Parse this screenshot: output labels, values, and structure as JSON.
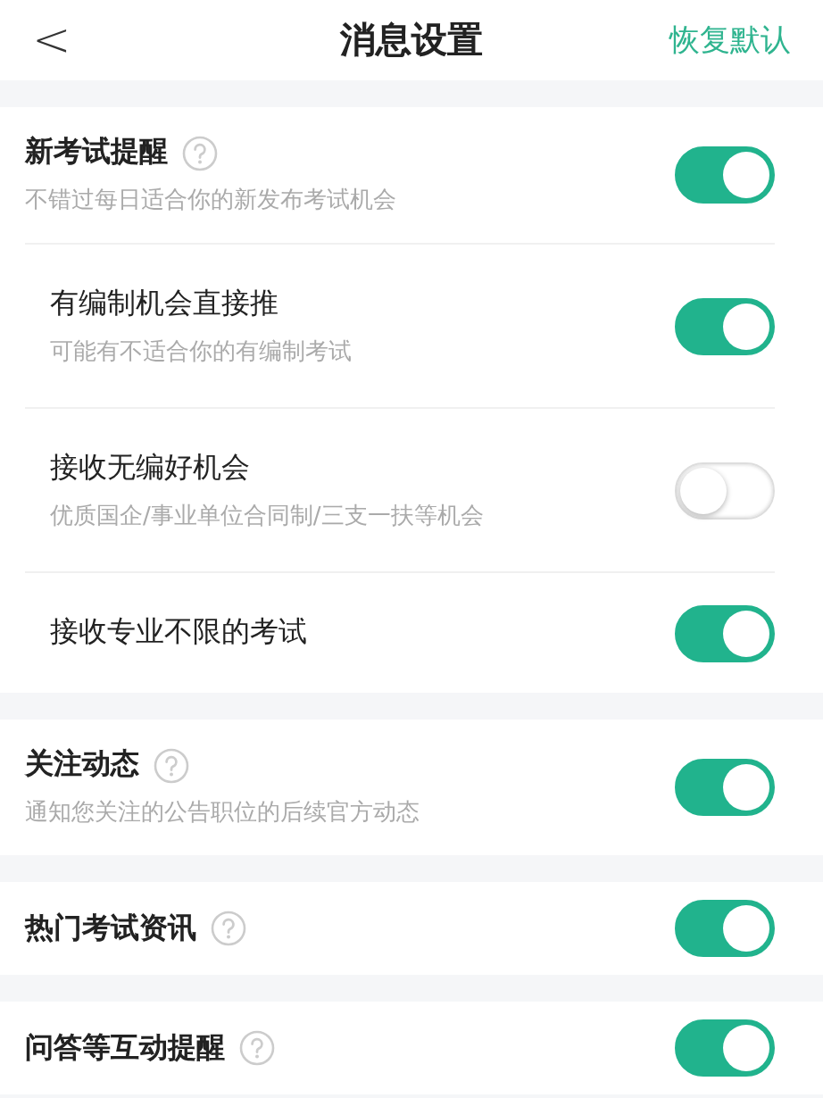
{
  "header": {
    "back": "<",
    "title": "消息设置",
    "action": "恢复默认"
  },
  "sections": [
    {
      "title": "新考试提醒",
      "help": true,
      "description": "不错过每日适合你的新发布考试机会",
      "on": true,
      "children": [
        {
          "title": "有编制机会直接推",
          "description": "可能有不适合你的有编制考试",
          "on": true
        },
        {
          "title": "接收无编好机会",
          "description": "优质国企/事业单位合同制/三支一扶等机会",
          "on": false
        },
        {
          "title": "接收专业不限的考试",
          "on": true
        }
      ]
    },
    {
      "title": "关注动态",
      "help": true,
      "description": "通知您关注的公告职位的后续官方动态",
      "on": true
    },
    {
      "title": "热门考试资讯",
      "help": true,
      "on": true
    },
    {
      "title": "问答等互动提醒",
      "help": true,
      "on": true
    }
  ]
}
